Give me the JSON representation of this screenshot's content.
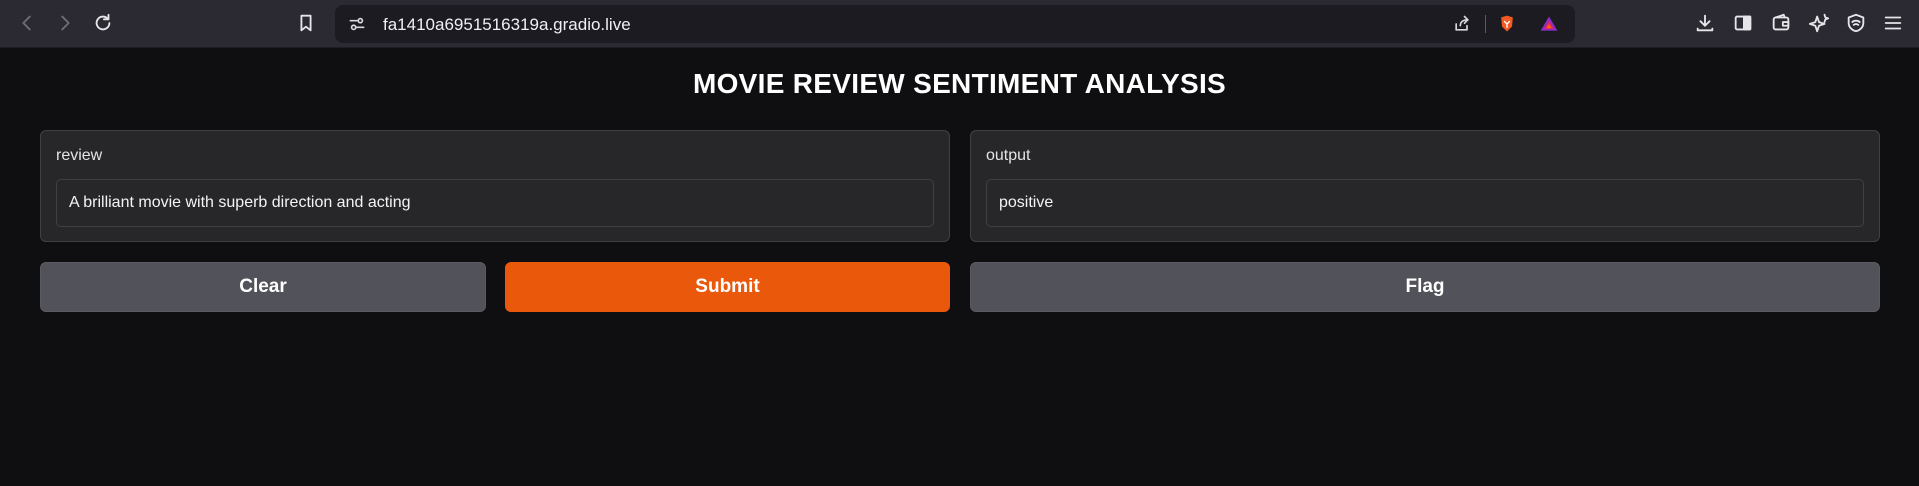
{
  "browser": {
    "url": "fa1410a6951516319a.gradio.live",
    "icons": [
      "back-icon",
      "forward-icon",
      "reload-icon",
      "bookmark-icon",
      "site-settings-icon",
      "share-icon",
      "brave-shields-icon",
      "brave-rewards-icon",
      "download-icon",
      "sidebar-icon",
      "wallet-icon",
      "leo-ai-icon",
      "vpn-icon",
      "menu-icon"
    ]
  },
  "app": {
    "title": "MOVIE REVIEW SENTIMENT ANALYSIS",
    "input": {
      "label": "review",
      "value": "A brilliant movie with superb direction and acting"
    },
    "output": {
      "label": "output",
      "value": "positive"
    },
    "buttons": {
      "clear": "Clear",
      "submit": "Submit",
      "flag": "Flag"
    }
  },
  "colors": {
    "background": "#0f0f11",
    "panel": "#27272a",
    "primary_button": "#ea580c",
    "secondary_button": "#52525b"
  }
}
